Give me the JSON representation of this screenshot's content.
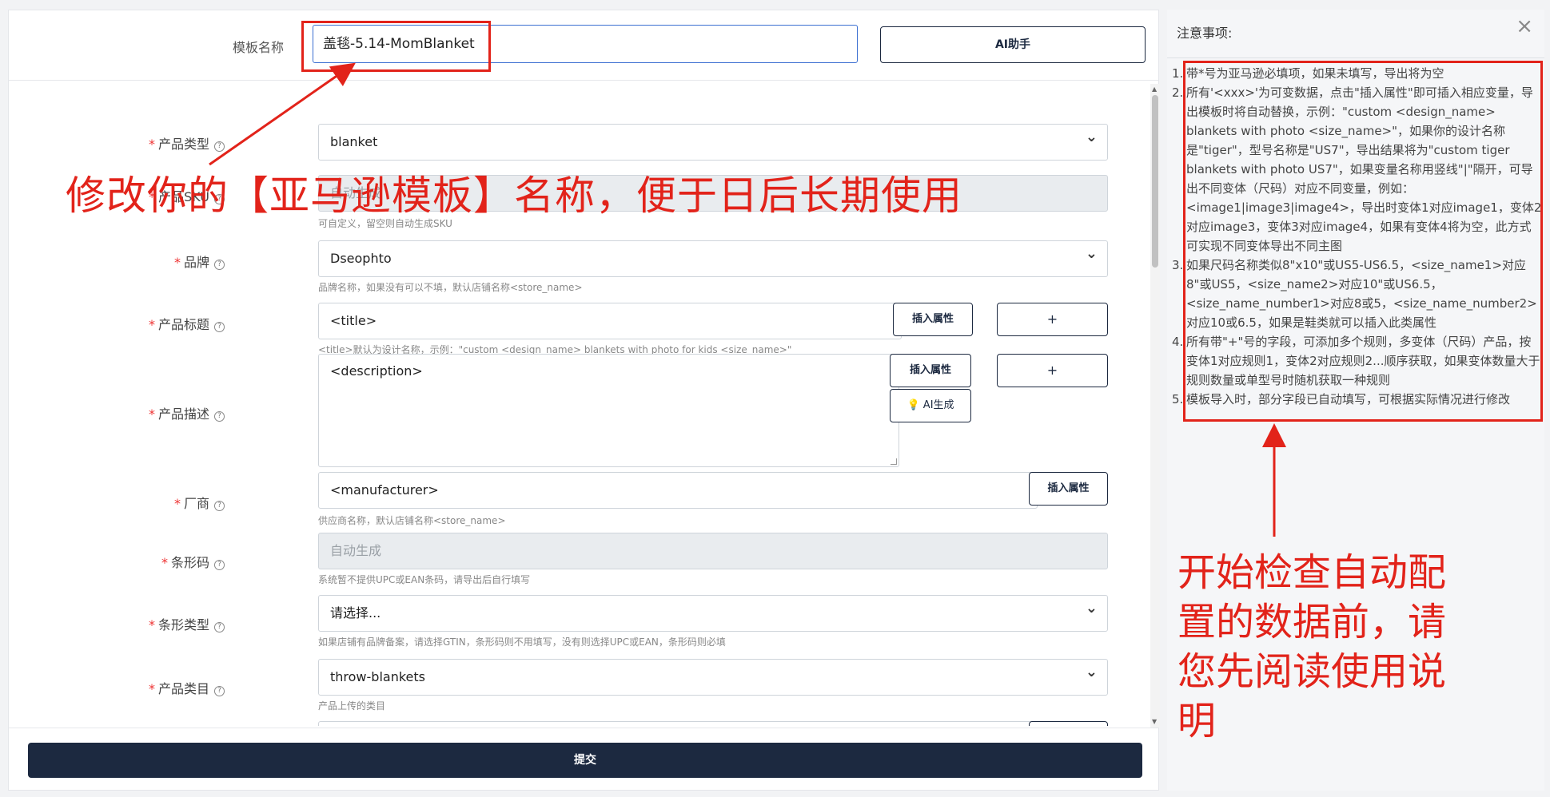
{
  "template": {
    "label": "模板名称",
    "value": "盖毯-5.14-MomBlanket",
    "ai_button": "AI助手"
  },
  "fields": {
    "product_type": {
      "label": "产品类型",
      "value": "blanket"
    },
    "product_sku": {
      "label": "产品SKU",
      "placeholder": "自动生成",
      "hint": "可自定义，留空则自动生成SKU"
    },
    "brand": {
      "label": "品牌",
      "value": "Dseophto",
      "hint": "品牌名称，如果没有可以不填，默认店铺名称<store_name>"
    },
    "title": {
      "label": "产品标题",
      "value": "<title>",
      "hint": "<title>默认为设计名称，示例：\"custom <design_name> blankets with photo for kids <size_name>\"",
      "insert_button": "插入属性",
      "add_button": "+"
    },
    "description": {
      "label": "产品描述",
      "value": "<description>",
      "insert_button": "插入属性",
      "add_button": "+",
      "ai_button": "AI生成"
    },
    "manufacturer": {
      "label": "厂商",
      "value": "<manufacturer>",
      "hint": "供应商名称，默认店铺名称<store_name>",
      "insert_button": "插入属性"
    },
    "barcode": {
      "label": "条形码",
      "placeholder": "自动生成",
      "hint": "系统暂不提供UPC或EAN条码，请导出后自行填写"
    },
    "barcode_type": {
      "label": "条形类型",
      "value": "请选择...",
      "hint": "如果店铺有品牌备案，请选择GTIN，条形码则不用填写，没有则选择UPC或EAN，条形码则必填"
    },
    "category": {
      "label": "产品类目",
      "value": "throw-blankets",
      "hint": "产品上传的类目"
    }
  },
  "submit_label": "提交",
  "notice": {
    "title": "注意事项:",
    "close": "×",
    "items": [
      {
        "num": "1.",
        "text": "带*号为亚马逊必填项，如果未填写，导出将为空"
      },
      {
        "num": "2.",
        "text": "所有'<xxx>'为可变数据，点击\"插入属性\"即可插入相应变量，导出模板时将自动替换，示例：\"custom <design_name> blankets with photo <size_name>\"，如果你的设计名称是\"tiger\"，型号名称是\"US7\"，导出结果将为\"custom tiger blankets with photo US7\"，如果变量名称用竖线\"|\"隔开，可导出不同变体（尺码）对应不同变量，例如：<image1|image3|image4>，导出时变体1对应image1，变体2对应image3，变体3对应image4，如果有变体4将为空，此方式可实现不同变体导出不同主图"
      },
      {
        "num": "3.",
        "text": "如果尺码名称类似8\"x10\"或US5-US6.5，<size_name1>对应8\"或US5，<size_name2>对应10\"或US6.5，<size_name_number1>对应8或5，<size_name_number2>对应10或6.5，如果是鞋类就可以插入此类属性"
      },
      {
        "num": "4.",
        "text": "所有带\"+\"号的字段，可添加多个规则，多变体（尺码）产品，按变体1对应规则1，变体2对应规则2...顺序获取，如果变体数量大于规则数量或单型号时随机获取一种规则"
      },
      {
        "num": "5.",
        "text": "模板导入时，部分字段已自动填写，可根据实际情况进行修改"
      }
    ]
  },
  "annotations": {
    "left": "修改你的【亚马逊模板】名称，便于日后长期使用",
    "right": "开始检查自动配置的数据前，请您先阅读使用说明"
  },
  "colors": {
    "primary": "#1c2940",
    "annotation": "#e2231a",
    "required": "#e33333",
    "focus_border": "#3b6fd1"
  }
}
